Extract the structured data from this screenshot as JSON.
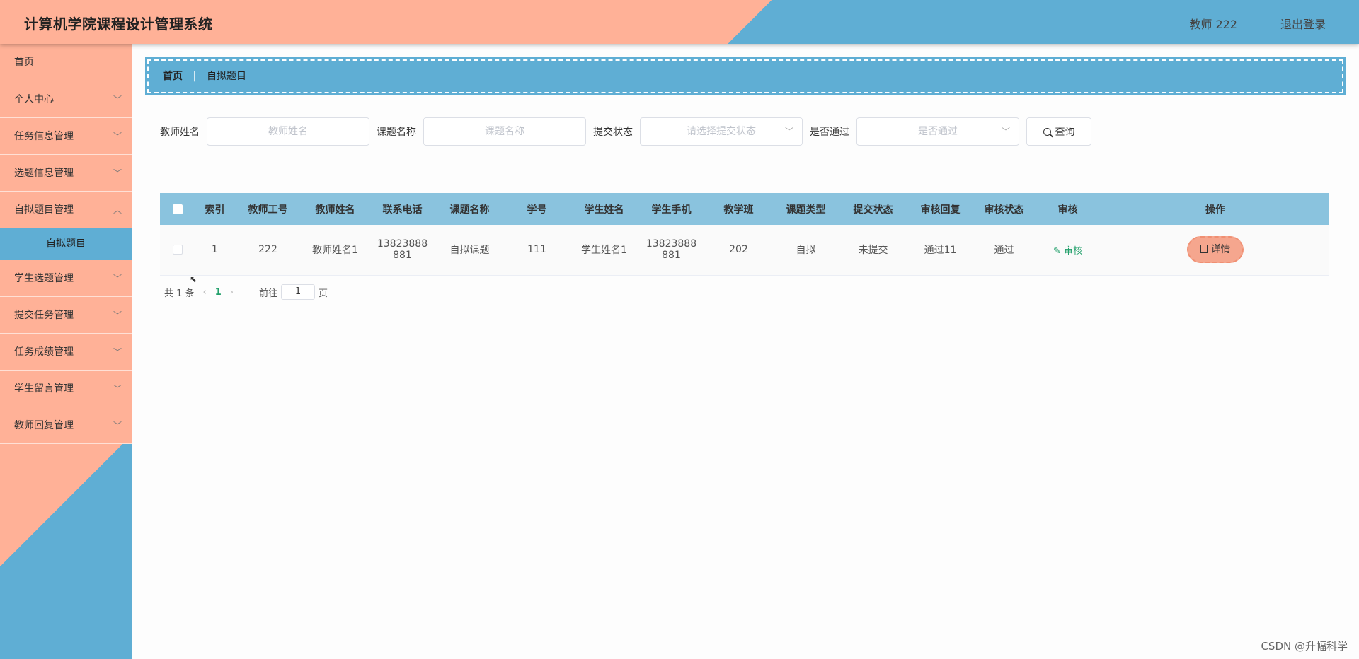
{
  "header": {
    "title": "计算机学院课程设计管理系统",
    "user": "教师 222",
    "logout": "退出登录"
  },
  "sidebar": {
    "items": [
      {
        "label": "首页"
      },
      {
        "label": "个人中心"
      },
      {
        "label": "任务信息管理"
      },
      {
        "label": "选题信息管理"
      },
      {
        "label": "自拟题目管理"
      },
      {
        "label": "学生选题管理"
      },
      {
        "label": "提交任务管理"
      },
      {
        "label": "任务成绩管理"
      },
      {
        "label": "学生留言管理"
      },
      {
        "label": "教师回复管理"
      }
    ],
    "submenu": {
      "label": "自拟题目"
    }
  },
  "breadcrumb": {
    "home": "首页",
    "separator": "|",
    "current": "自拟题目"
  },
  "search": {
    "teacher_name_label": "教师姓名",
    "teacher_name_placeholder": "教师姓名",
    "topic_name_label": "课题名称",
    "topic_name_placeholder": "课题名称",
    "submit_status_label": "提交状态",
    "submit_status_placeholder": "请选择提交状态",
    "passed_label": "是否通过",
    "passed_placeholder": "是否通过",
    "query_button": "查询"
  },
  "table": {
    "columns": [
      "索引",
      "教师工号",
      "教师姓名",
      "联系电话",
      "课题名称",
      "学号",
      "学生姓名",
      "学生手机",
      "教学班",
      "课题类型",
      "提交状态",
      "审核回复",
      "审核状态",
      "审核",
      "操作"
    ],
    "rows": [
      {
        "index": "1",
        "teacher_id": "222",
        "teacher_name": "教师姓名1",
        "phone_line1": "13823888",
        "phone_line2": "881",
        "topic_name": "自拟课题",
        "student_id": "111",
        "student_name": "学生姓名1",
        "student_phone_line1": "13823888",
        "student_phone_line2": "881",
        "class": "202",
        "topic_type": "自拟",
        "submit_status": "未提交",
        "review_reply": "通过11",
        "review_status": "通过",
        "review_action": "审核",
        "detail_action": "详情"
      }
    ]
  },
  "pagination": {
    "total": "共 1 条",
    "current_page": "1",
    "goto_label": "前往",
    "goto_value": "1",
    "page_suffix": "页"
  },
  "watermark": "CSDN @升幅科学",
  "colors": {
    "salmon": "#ffb197",
    "blue": "#5faed4",
    "table_header": "#8ac3de",
    "accent_green": "#22a06b"
  }
}
